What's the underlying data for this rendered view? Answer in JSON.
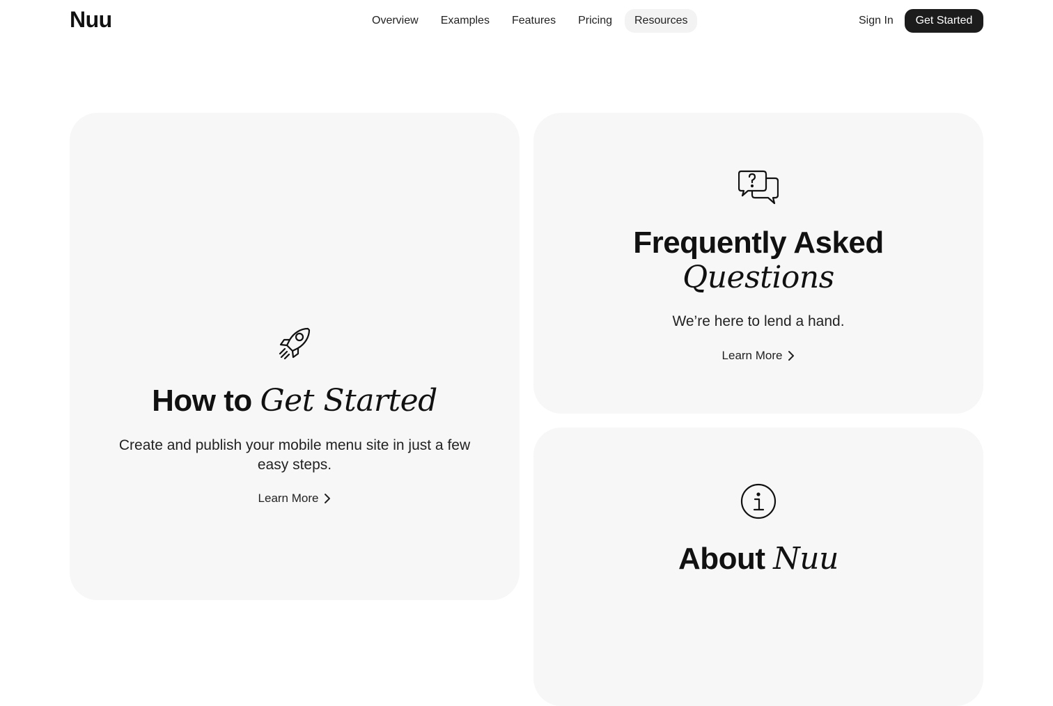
{
  "nav": {
    "logo": "Nuu",
    "links": [
      {
        "label": "Overview"
      },
      {
        "label": "Examples"
      },
      {
        "label": "Features"
      },
      {
        "label": "Pricing"
      },
      {
        "label": "Resources"
      }
    ],
    "sign_in": "Sign In",
    "get_started": "Get Started"
  },
  "cards": {
    "get_started": {
      "icon": "rocket-icon",
      "title_plain": "How to",
      "title_italic": "Get Started",
      "desc": "Create and publish your mobile menu site in just a few easy steps.",
      "cta": "Learn More"
    },
    "faq": {
      "icon": "chat-question-icon",
      "title_plain": "Frequently Asked",
      "title_italic": "Questions",
      "desc": "We’re here to lend a hand.",
      "cta": "Learn More"
    },
    "about": {
      "icon": "info-icon",
      "title_plain": "About",
      "title_italic": "Nuu"
    }
  },
  "colors": {
    "card_bg": "#f7f7f7",
    "primary_button": "#1c1c1c",
    "active_nav_bg": "#f3f3f3"
  }
}
